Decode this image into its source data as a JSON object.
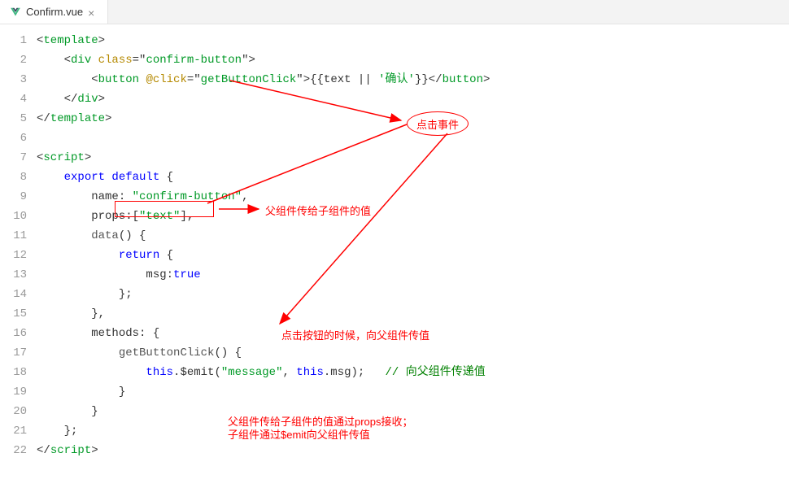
{
  "tab": {
    "title": "Confirm.vue"
  },
  "code": {
    "lines": [
      {
        "num": 1,
        "indent": 0,
        "parts": [
          {
            "t": "<",
            "c": "bracket"
          },
          {
            "t": "template",
            "c": "tag"
          },
          {
            "t": ">",
            "c": "bracket"
          }
        ]
      },
      {
        "num": 2,
        "indent": 1,
        "parts": [
          {
            "t": "<",
            "c": "bracket"
          },
          {
            "t": "div ",
            "c": "tag"
          },
          {
            "t": "class",
            "c": "attr-name"
          },
          {
            "t": "=\"",
            "c": "punct"
          },
          {
            "t": "confirm-button",
            "c": "attr-value"
          },
          {
            "t": "\">",
            "c": "punct"
          }
        ]
      },
      {
        "num": 3,
        "indent": 2,
        "parts": [
          {
            "t": "<",
            "c": "bracket"
          },
          {
            "t": "button ",
            "c": "tag"
          },
          {
            "t": "@click",
            "c": "attr-name"
          },
          {
            "t": "=\"",
            "c": "punct"
          },
          {
            "t": "getButtonClick",
            "c": "attr-value"
          },
          {
            "t": "\">",
            "c": "punct"
          },
          {
            "t": "{{",
            "c": "punct"
          },
          {
            "t": "text || ",
            "c": "identifier"
          },
          {
            "t": "'确认'",
            "c": "string"
          },
          {
            "t": "}}",
            "c": "punct"
          },
          {
            "t": "</",
            "c": "bracket"
          },
          {
            "t": "button",
            "c": "tag"
          },
          {
            "t": ">",
            "c": "bracket"
          }
        ]
      },
      {
        "num": 4,
        "indent": 1,
        "parts": [
          {
            "t": "</",
            "c": "bracket"
          },
          {
            "t": "div",
            "c": "tag"
          },
          {
            "t": ">",
            "c": "bracket"
          }
        ]
      },
      {
        "num": 5,
        "indent": 0,
        "parts": [
          {
            "t": "</",
            "c": "bracket"
          },
          {
            "t": "template",
            "c": "tag"
          },
          {
            "t": ">",
            "c": "bracket"
          }
        ]
      },
      {
        "num": 6,
        "indent": 0,
        "parts": []
      },
      {
        "num": 7,
        "indent": 0,
        "parts": [
          {
            "t": "<",
            "c": "bracket"
          },
          {
            "t": "script",
            "c": "tag"
          },
          {
            "t": ">",
            "c": "bracket"
          }
        ]
      },
      {
        "num": 8,
        "indent": 1,
        "parts": [
          {
            "t": "export default ",
            "c": "keyword"
          },
          {
            "t": "{",
            "c": "punct"
          }
        ]
      },
      {
        "num": 9,
        "indent": 2,
        "parts": [
          {
            "t": "name: ",
            "c": "property"
          },
          {
            "t": "\"confirm-button\"",
            "c": "string"
          },
          {
            "t": ",",
            "c": "punct"
          }
        ]
      },
      {
        "num": 10,
        "indent": 2,
        "parts": [
          {
            "t": "props:[",
            "c": "property"
          },
          {
            "t": "\"text\"",
            "c": "string"
          },
          {
            "t": "],",
            "c": "punct"
          }
        ]
      },
      {
        "num": 11,
        "indent": 2,
        "parts": [
          {
            "t": "data",
            "c": "method-name"
          },
          {
            "t": "() {",
            "c": "punct"
          }
        ]
      },
      {
        "num": 12,
        "indent": 3,
        "parts": [
          {
            "t": "return ",
            "c": "keyword"
          },
          {
            "t": "{",
            "c": "punct"
          }
        ]
      },
      {
        "num": 13,
        "indent": 4,
        "parts": [
          {
            "t": "msg:",
            "c": "property"
          },
          {
            "t": "true",
            "c": "boolean-lit"
          }
        ]
      },
      {
        "num": 14,
        "indent": 3,
        "parts": [
          {
            "t": "};",
            "c": "punct"
          }
        ]
      },
      {
        "num": 15,
        "indent": 2,
        "parts": [
          {
            "t": "},",
            "c": "punct"
          }
        ]
      },
      {
        "num": 16,
        "indent": 2,
        "parts": [
          {
            "t": "methods: {",
            "c": "property"
          }
        ]
      },
      {
        "num": 17,
        "indent": 3,
        "parts": [
          {
            "t": "getButtonClick",
            "c": "method-name"
          },
          {
            "t": "() {",
            "c": "punct"
          }
        ]
      },
      {
        "num": 18,
        "indent": 4,
        "parts": [
          {
            "t": "this",
            "c": "keyword"
          },
          {
            "t": ".",
            "c": "punct"
          },
          {
            "t": "$emit",
            "c": "dollar"
          },
          {
            "t": "(",
            "c": "punct"
          },
          {
            "t": "\"message\"",
            "c": "string"
          },
          {
            "t": ", ",
            "c": "punct"
          },
          {
            "t": "this",
            "c": "keyword"
          },
          {
            "t": ".msg);   ",
            "c": "punct"
          },
          {
            "t": "// 向父组件传递值",
            "c": "comment"
          }
        ]
      },
      {
        "num": 19,
        "indent": 3,
        "parts": [
          {
            "t": "}",
            "c": "punct"
          }
        ]
      },
      {
        "num": 20,
        "indent": 2,
        "parts": [
          {
            "t": "}",
            "c": "punct"
          }
        ]
      },
      {
        "num": 21,
        "indent": 1,
        "parts": [
          {
            "t": "};",
            "c": "punct"
          }
        ]
      },
      {
        "num": 22,
        "indent": 0,
        "parts": [
          {
            "t": "</",
            "c": "bracket"
          },
          {
            "t": "script",
            "c": "tag"
          },
          {
            "t": ">",
            "c": "bracket"
          }
        ]
      }
    ]
  },
  "annotations": {
    "clickEvent": "点击事件",
    "propsNote": "父组件传给子组件的值",
    "emitNote": "点击按钮的时候，向父组件传值",
    "summaryLine1": "父组件传给子组件的值通过props接收；",
    "summaryLine2": "子组件通过$emit向父组件传值"
  }
}
